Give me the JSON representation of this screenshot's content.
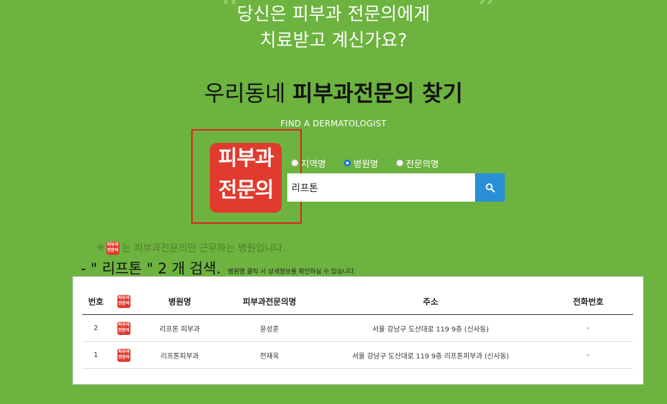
{
  "header": {
    "line1": "당신은 피부과 전문의에게",
    "line2": "치료받고 계신가요?",
    "quote_open": "“",
    "quote_close": "”"
  },
  "title": {
    "prefix": "우리동네",
    "bold": "피부과전문의 찾기",
    "subtitle": "FIND A DERMATOLOGIST"
  },
  "logo": {
    "line1": "피부과",
    "line2": "전문의"
  },
  "search": {
    "options": [
      {
        "label": "지역명",
        "checked": false
      },
      {
        "label": "병원명",
        "checked": true
      },
      {
        "label": "전문의명",
        "checked": false
      }
    ],
    "value": "리프톤",
    "button_icon": "search-icon"
  },
  "notice": {
    "prefix": "※",
    "text": "는 피부과전문의만 근무하는 병원입니다."
  },
  "result": {
    "summary": "- \" 리프톤 \" 2 개 검색.",
    "hint": "병원명 클릭 시 상세정보를 확인하실 수 있습니다."
  },
  "table": {
    "headers": {
      "no": "번호",
      "hospital": "병원명",
      "doctor": "피부과전문의명",
      "address": "주소",
      "phone": "전화번호"
    },
    "rows": [
      {
        "no": "2",
        "hospital": "리프톤 피부과",
        "doctor": "윤성훈",
        "address": "서울 강남구 도산대로 119 9층 (신사동)",
        "phone": "-"
      },
      {
        "no": "1",
        "hospital": "리프톤피부과",
        "doctor": "전재욱",
        "address": "서울 강남구 도산대로 119 9층 리프톤피부과 (신사동)",
        "phone": "-"
      }
    ]
  },
  "colors": {
    "background": "#6db33f",
    "accent_red": "#e03b2e",
    "search_button": "#2a8fd6"
  }
}
